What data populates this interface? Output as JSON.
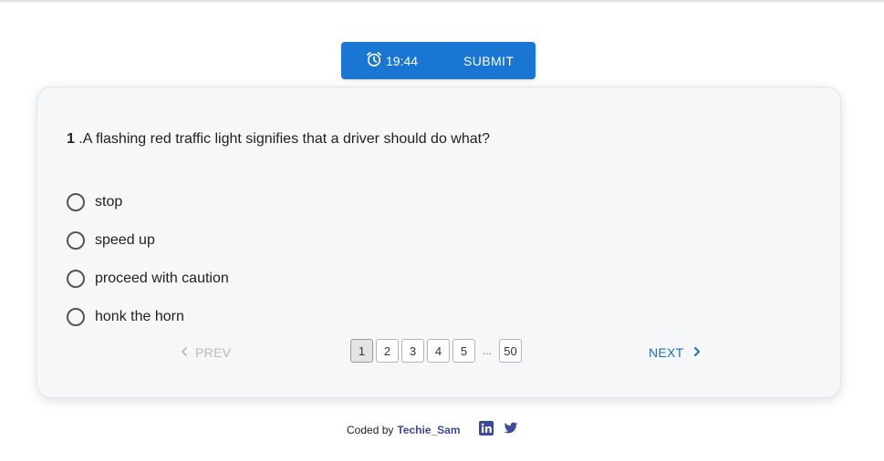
{
  "header": {
    "timer_value": "19:44",
    "submit_label": "SUBMIT",
    "accent_color": "#1976d2"
  },
  "question": {
    "number": "1",
    "text": " .A flashing red traffic light signifies that a driver should do what?"
  },
  "options": [
    {
      "label": "stop"
    },
    {
      "label": "speed up"
    },
    {
      "label": "proceed with caution"
    },
    {
      "label": "honk the horn"
    }
  ],
  "pagination": {
    "prev_label": "PREV",
    "next_label": "NEXT",
    "pages": [
      "1",
      "2",
      "3",
      "4",
      "5"
    ],
    "ellipsis": "...",
    "last_page": "50",
    "current_page": "1"
  },
  "footer": {
    "coded_by": "Coded by",
    "author": "Techie_Sam",
    "icons": [
      "linkedin-icon",
      "twitter-icon"
    ]
  }
}
